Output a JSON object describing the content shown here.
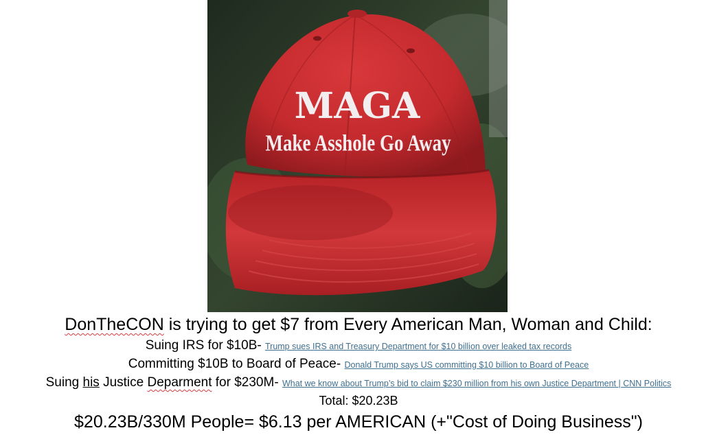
{
  "image": {
    "cap_title": "MAGA",
    "cap_subtitle": "Make Asshole Go Away",
    "cap_color": "#c62a2e",
    "background_color": "#2c3a2c"
  },
  "headline": {
    "name": "DonTheCON",
    "rest": " is trying to get $7 from Every American Man, Woman and Child:"
  },
  "items": [
    {
      "prefix": "Suing IRS for $10B- ",
      "link": "Trump sues IRS and Treasury Department for $10 billion over leaked tax records"
    },
    {
      "prefix": "Committing $10B to Board of Peace- ",
      "link": "Donald Trump says US committing $10 billion to Board of Peace"
    },
    {
      "prefix_a": "Suing ",
      "prefix_his": "his",
      "prefix_b": " Justice ",
      "prefix_dep": "Deparment",
      "prefix_c": " for $230M- ",
      "link": "What we know about Trump’s bid to claim $230 million from his own Justice Department | CNN Politics"
    }
  ],
  "total": "Total: $20.23B",
  "summary": "$20.23B/330M People= $6.13 per AMERICAN (+\"Cost of Doing Business\")"
}
